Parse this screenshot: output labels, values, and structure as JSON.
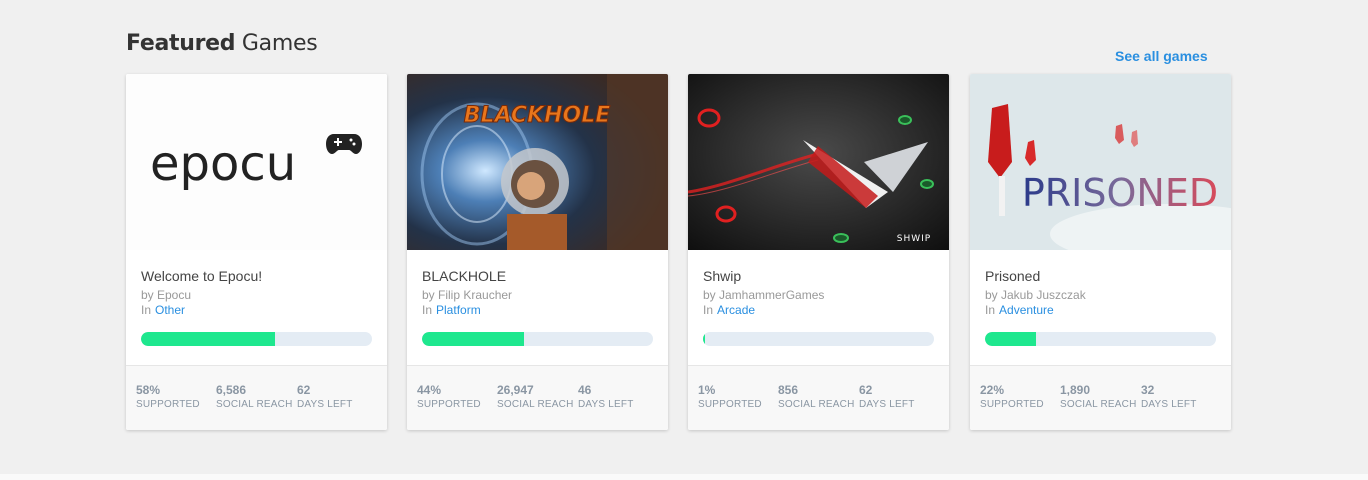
{
  "header": {
    "title_bold": "Featured",
    "title_rest": " Games",
    "see_all": "See all games"
  },
  "colors": {
    "accent": "#2a8fe0",
    "progress_fill": "#1ee78e",
    "progress_track": "#e4ecf4"
  },
  "games": [
    {
      "title": "Welcome to Epocu!",
      "by": "by Epocu",
      "in": "In",
      "category": "Other",
      "progress": 0.58,
      "supported": "58%",
      "reach": "6,586",
      "days": "62",
      "thumb_text": "epocu",
      "thumb_icon": "gamepad-icon"
    },
    {
      "title": "BLACKHOLE",
      "by": "by Filip Kraucher",
      "in": "In",
      "category": "Platform",
      "progress": 0.44,
      "supported": "44%",
      "reach": "26,947",
      "days": "46",
      "thumb_text": "BLACKHOLE"
    },
    {
      "title": "Shwip",
      "by": "by JamhammerGames",
      "in": "In",
      "category": "Arcade",
      "progress": 0.01,
      "supported": "1%",
      "reach": "856",
      "days": "62",
      "thumb_text": "SHWIP"
    },
    {
      "title": "Prisoned",
      "by": "by Jakub Juszczak",
      "in": "In",
      "category": "Adventure",
      "progress": 0.22,
      "supported": "22%",
      "reach": "1,890",
      "days": "32",
      "thumb_text": "PRISONED"
    }
  ],
  "labels": {
    "supported": "SUPPORTED",
    "reach": "SOCIAL REACH",
    "days": "DAYS LEFT"
  }
}
